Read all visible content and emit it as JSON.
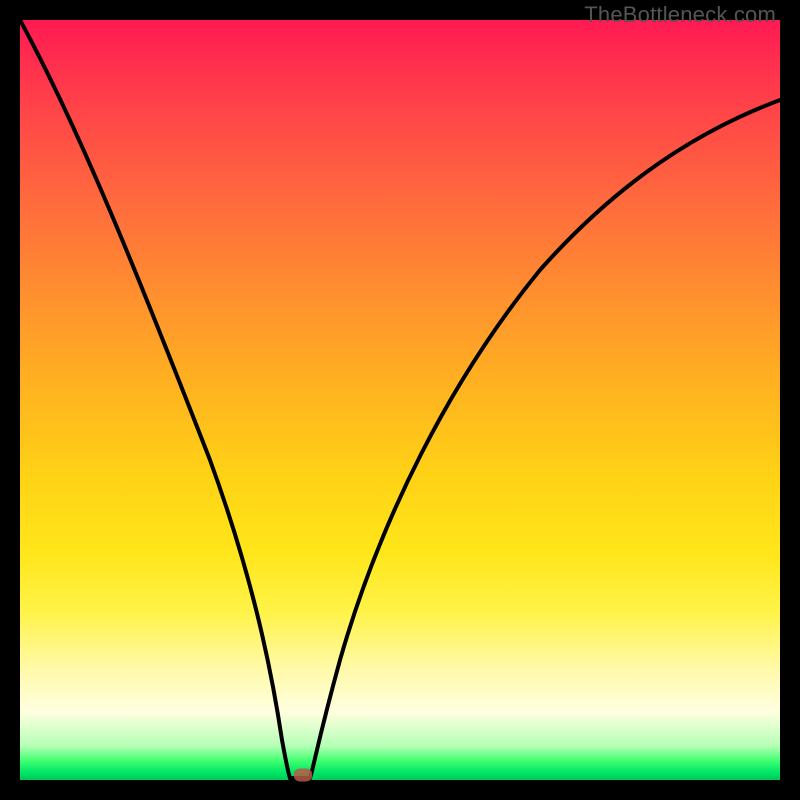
{
  "watermark": "TheBottleneck.com",
  "colors": {
    "frame": "#000000",
    "curve": "#000000",
    "marker": "#b65a47",
    "gradient_top": "#ff1a52",
    "gradient_mid": "#ffe61a",
    "gradient_bottom": "#00c957"
  },
  "chart_data": {
    "type": "line",
    "title": "",
    "xlabel": "",
    "ylabel": "",
    "xlim": [
      0,
      100
    ],
    "ylim": [
      0,
      100
    ],
    "grid": false,
    "legend": false,
    "x": [
      0,
      2,
      4,
      6,
      8,
      10,
      12,
      14,
      16,
      18,
      20,
      22,
      24,
      26,
      28,
      30,
      32,
      33,
      34,
      35,
      36,
      37,
      38,
      40,
      42,
      44,
      46,
      48,
      50,
      54,
      58,
      62,
      66,
      70,
      74,
      78,
      82,
      86,
      90,
      94,
      98,
      100
    ],
    "y": [
      100,
      95,
      90,
      85,
      79,
      74,
      68,
      62,
      56,
      50,
      44,
      38,
      32,
      26,
      20,
      14,
      8,
      4,
      1,
      0,
      0,
      0,
      2,
      7,
      12,
      18,
      23,
      28,
      33,
      42,
      50,
      57,
      63,
      68,
      72,
      76,
      79,
      82,
      84,
      86,
      88,
      89
    ],
    "marker": {
      "x": 36,
      "y": 0
    },
    "annotations": []
  }
}
